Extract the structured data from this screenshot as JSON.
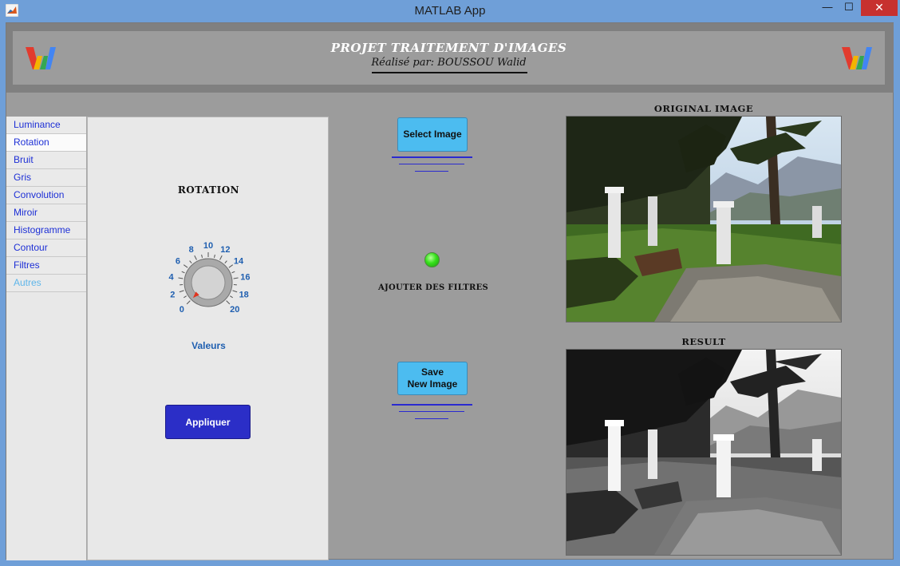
{
  "window": {
    "title": "MATLAB App",
    "controls": {
      "minimize": "—",
      "maximize": "☐",
      "close": "✕"
    }
  },
  "header": {
    "title": "PROJET TRAITEMENT D'IMAGES",
    "author": "Réalisé par: BOUSSOU Walid",
    "logo_icon": "w-logo-icon"
  },
  "tabs": [
    {
      "label": "Luminance",
      "state": "normal"
    },
    {
      "label": "Rotation",
      "state": "active"
    },
    {
      "label": "Bruit",
      "state": "normal"
    },
    {
      "label": "Gris",
      "state": "normal"
    },
    {
      "label": "Convolution",
      "state": "normal"
    },
    {
      "label": "Miroir",
      "state": "normal"
    },
    {
      "label": "Histogramme",
      "state": "normal"
    },
    {
      "label": "Contour",
      "state": "normal"
    },
    {
      "label": "Filtres",
      "state": "normal"
    },
    {
      "label": "Autres",
      "state": "disabled"
    }
  ],
  "rotation_panel": {
    "title": "ROTATION",
    "knob": {
      "label": "Valeurs",
      "min": 0,
      "max": 20,
      "value": 0,
      "ticks": [
        "0",
        "2",
        "4",
        "6",
        "8",
        "10",
        "12",
        "14",
        "16",
        "18",
        "20"
      ]
    },
    "apply_label": "Appliquer"
  },
  "actions": {
    "select_label": "Select Image",
    "save_label_line1": "Save",
    "save_label_line2": "New Image",
    "lamp_status": "on",
    "lamp_color": "#35e01a",
    "filters_label": "AJOUTER DES FILTRES"
  },
  "images": {
    "original_title": "ORIGINAL IMAGE",
    "result_title": "RESULT"
  },
  "colors": {
    "accent_blue": "#4cbcf0",
    "apply_blue": "#2b2ec7",
    "tab_text": "#1d2fd6",
    "disabled_tab": "#5fb6ea"
  }
}
